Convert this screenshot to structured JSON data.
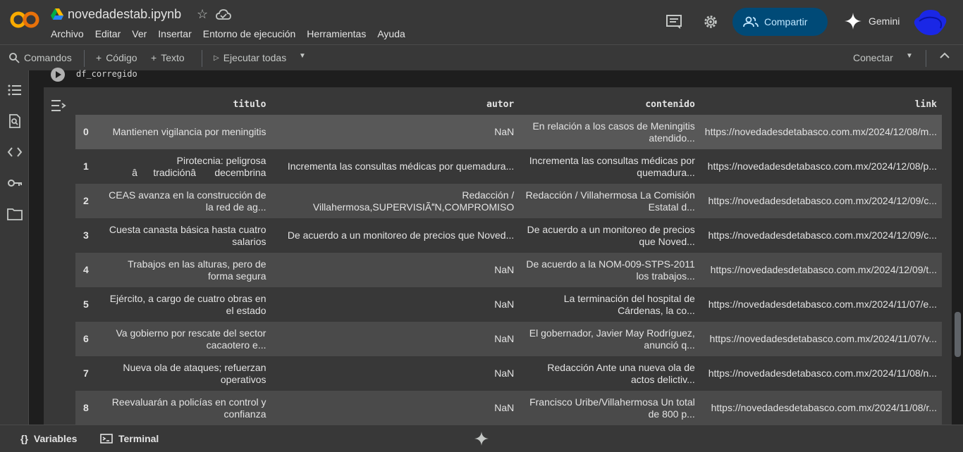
{
  "header": {
    "notebook_title": "novedadestab.ipynb",
    "menu": [
      "Archivo",
      "Editar",
      "Ver",
      "Insertar",
      "Entorno de ejecución",
      "Herramientas",
      "Ayuda"
    ],
    "share_label": "Compartir",
    "gemini_label": "Gemini"
  },
  "toolbar": {
    "commands_label": "Comandos",
    "code_label": "Código",
    "text_label": "Texto",
    "run_all_label": "Ejecutar todas",
    "connect_label": "Conectar"
  },
  "cell": {
    "code": "df_corregido"
  },
  "table": {
    "columns": [
      "titulo",
      "autor",
      "contenido",
      "link"
    ],
    "rows": [
      {
        "idx": "0",
        "titulo": "Mantienen vigilancia por meningitis",
        "autor": "NaN",
        "contenido": "En relación a los casos de Meningitis atendido...",
        "link": "https://novedadesdetabasco.com.mx/2024/12/08/m..."
      },
      {
        "idx": "1",
        "titulo": "Pirotecnia: peligrosa âtradiciónâ decembrina",
        "autor": "Incrementa las consultas médicas por quemadura...",
        "contenido": "Incrementa las consultas médicas por quemadura...",
        "link": "https://novedadesdetabasco.com.mx/2024/12/08/p..."
      },
      {
        "idx": "2",
        "titulo": "CEAS avanza en la construcción de la red de ag...",
        "autor": "Redacción / Villahermosa,SUPERVISIÃN,COMPROMISO",
        "contenido": "Redacción / Villahermosa La Comisión Estatal d...",
        "link": "https://novedadesdetabasco.com.mx/2024/12/09/c..."
      },
      {
        "idx": "3",
        "titulo": "Cuesta canasta básica hasta cuatro salarios",
        "autor": "De acuerdo a un monitoreo de precios que Noved...",
        "contenido": "De acuerdo a un monitoreo de precios que Noved...",
        "link": "https://novedadesdetabasco.com.mx/2024/12/09/c..."
      },
      {
        "idx": "4",
        "titulo": "Trabajos en las alturas, pero de forma segura",
        "autor": "NaN",
        "contenido": "De acuerdo a la NOM-009-STPS-2011 los trabajos...",
        "link": "https://novedadesdetabasco.com.mx/2024/12/09/t..."
      },
      {
        "idx": "5",
        "titulo": "Ejército, a cargo de cuatro obras en el estado",
        "autor": "NaN",
        "contenido": "La terminación del hospital de Cárdenas, la co...",
        "link": "https://novedadesdetabasco.com.mx/2024/11/07/e..."
      },
      {
        "idx": "6",
        "titulo": "Va gobierno por rescate del sector cacaotero e...",
        "autor": "NaN",
        "contenido": "El gobernador, Javier May Rodríguez, anunció q...",
        "link": "https://novedadesdetabasco.com.mx/2024/11/07/v..."
      },
      {
        "idx": "7",
        "titulo": "Nueva ola de ataques; refuerzan operativos",
        "autor": "NaN",
        "contenido": "Redacción Ante una nueva ola de actos delictiv...",
        "link": "https://novedadesdetabasco.com.mx/2024/11/08/n..."
      },
      {
        "idx": "8",
        "titulo": "Reevaluarán a policías en control y confianza",
        "autor": "NaN",
        "contenido": "Francisco Uribe/Villahermosa Un total de 800 p...",
        "link": "https://novedadesdetabasco.com.mx/2024/11/08/r..."
      }
    ]
  },
  "bottombar": {
    "variables_label": "Variables",
    "terminal_label": "Terminal"
  },
  "colors": {
    "share_bg": "#004a77",
    "logo_orange": "#f9ab00",
    "logo_dark": "#e8710a"
  }
}
